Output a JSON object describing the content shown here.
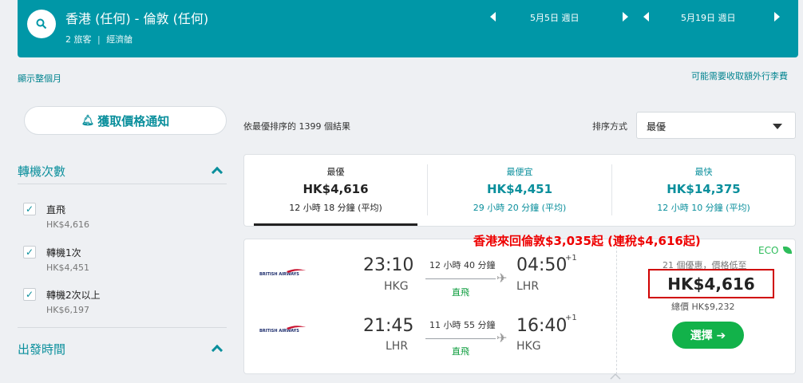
{
  "header": {
    "route": "香港 (任何) - 倫敦 (任何)",
    "passengers": "2 旅客",
    "cabin": "經濟艙",
    "depart_date": "5月5日 週日",
    "return_date": "5月19日 週日"
  },
  "links": {
    "show_month": "顯示整個月",
    "extra_fees": "可能需要收取額外行李費"
  },
  "price_alert": {
    "label": "獲取價格通知"
  },
  "filters": {
    "stops_title": "轉機次數",
    "stops": [
      {
        "label": "直飛",
        "price": "HK$4,616",
        "checked": true
      },
      {
        "label": "轉機1次",
        "price": "HK$4,451",
        "checked": true
      },
      {
        "label": "轉機2次以上",
        "price": "HK$6,197",
        "checked": true
      }
    ],
    "departure_title": "出發時間"
  },
  "results": {
    "count_text": "依最優排序的 1399 個結果",
    "sort_label": "排序方式",
    "sort_value": "最優"
  },
  "tabs": [
    {
      "title": "最優",
      "price": "HK$4,616",
      "duration": "12 小時 18 分鐘 (平均)"
    },
    {
      "title": "最便宜",
      "price": "HK$4,451",
      "duration": "29 小時 20 分鐘 (平均)"
    },
    {
      "title": "最快",
      "price": "HK$14,375",
      "duration": "12 小時 10 分鐘 (平均)"
    }
  ],
  "promo": "香港來回倫敦$3,035起 (連稅$4,616起)",
  "flight": {
    "airline_logo": "BRITISH AIRWAYS",
    "outbound": {
      "dep_time": "23:10",
      "dep": "HKG",
      "arr_time": "04:50",
      "arr": "LHR",
      "plus": "+1",
      "duration": "12 小時 40 分鐘",
      "stops": "直飛"
    },
    "inbound": {
      "dep_time": "21:45",
      "dep": "LHR",
      "arr_time": "16:40",
      "arr": "HKG",
      "plus": "+1",
      "duration": "11 小時 55 分鐘",
      "stops": "直飛"
    },
    "eco": "ECO",
    "deals": "21 個優惠，價格低至",
    "price": "HK$4,616",
    "total": "總價 HK$9,232",
    "select": "選擇 ➔"
  },
  "colors": {
    "brand": "#0097a7",
    "accent": "#0a8f9c",
    "cta": "#12b24a",
    "highlight": "#d00000"
  }
}
